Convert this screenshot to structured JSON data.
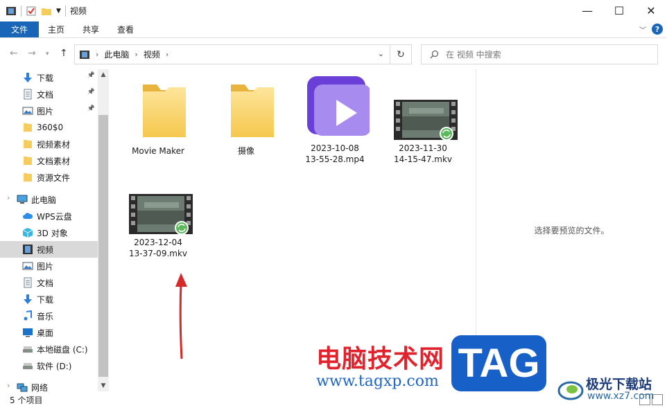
{
  "window": {
    "title": "视频",
    "controls": {
      "minimize": "—",
      "maximize": "☐",
      "close": "✕"
    }
  },
  "ribbon": {
    "tabs": [
      "文件",
      "主页",
      "共享",
      "查看"
    ]
  },
  "address": {
    "crumbs": [
      "此电脑",
      "视频"
    ]
  },
  "search": {
    "placeholder": "在 视频 中搜索"
  },
  "sidebar": {
    "items": [
      {
        "label": "下载",
        "icon": "download-icon",
        "pinned": true
      },
      {
        "label": "文档",
        "icon": "document-icon",
        "pinned": true
      },
      {
        "label": "图片",
        "icon": "picture-icon",
        "pinned": true
      },
      {
        "label": "360$0",
        "icon": "folder-icon"
      },
      {
        "label": "视频素材",
        "icon": "folder-icon"
      },
      {
        "label": "文档素材",
        "icon": "folder-icon"
      },
      {
        "label": "资源文件",
        "icon": "folder-icon"
      },
      {
        "label": "此电脑",
        "icon": "computer-icon"
      },
      {
        "label": "WPS云盘",
        "icon": "cloud-icon"
      },
      {
        "label": "3D 对象",
        "icon": "cube-icon"
      },
      {
        "label": "视频",
        "icon": "video-icon",
        "selected": true
      },
      {
        "label": "图片",
        "icon": "picture-icon"
      },
      {
        "label": "文档",
        "icon": "document-icon"
      },
      {
        "label": "下载",
        "icon": "download-icon"
      },
      {
        "label": "音乐",
        "icon": "music-icon"
      },
      {
        "label": "桌面",
        "icon": "desktop-icon"
      },
      {
        "label": "本地磁盘 (C:)",
        "icon": "drive-icon"
      },
      {
        "label": "软件 (D:)",
        "icon": "drive-icon"
      },
      {
        "label": "网络",
        "icon": "network-icon"
      }
    ]
  },
  "files": [
    {
      "name_line1": "Movie Maker",
      "name_line2": "",
      "kind": "folder"
    },
    {
      "name_line1": "摄像",
      "name_line2": "",
      "kind": "folder"
    },
    {
      "name_line1": "2023-10-08",
      "name_line2": "13-55-28.mp4",
      "kind": "mp4"
    },
    {
      "name_line1": "2023-11-30",
      "name_line2": "14-15-47.mkv",
      "kind": "mkv"
    },
    {
      "name_line1": "2023-12-04",
      "name_line2": "13-37-09.mkv",
      "kind": "mkv"
    }
  ],
  "preview": {
    "message": "选择要预览的文件。"
  },
  "status": {
    "count": "5 个项目"
  },
  "watermark": {
    "cn": "电脑技术网",
    "url": "www.tagxp.com",
    "tag": "TAG",
    "site_cn": "极光下载站",
    "site_url": "www.xz7.com"
  },
  "colors": {
    "accent": "#1966b8",
    "arrow": "#d42a2a",
    "folder": "#f6cd5c",
    "selected": "#d9d9d9"
  }
}
